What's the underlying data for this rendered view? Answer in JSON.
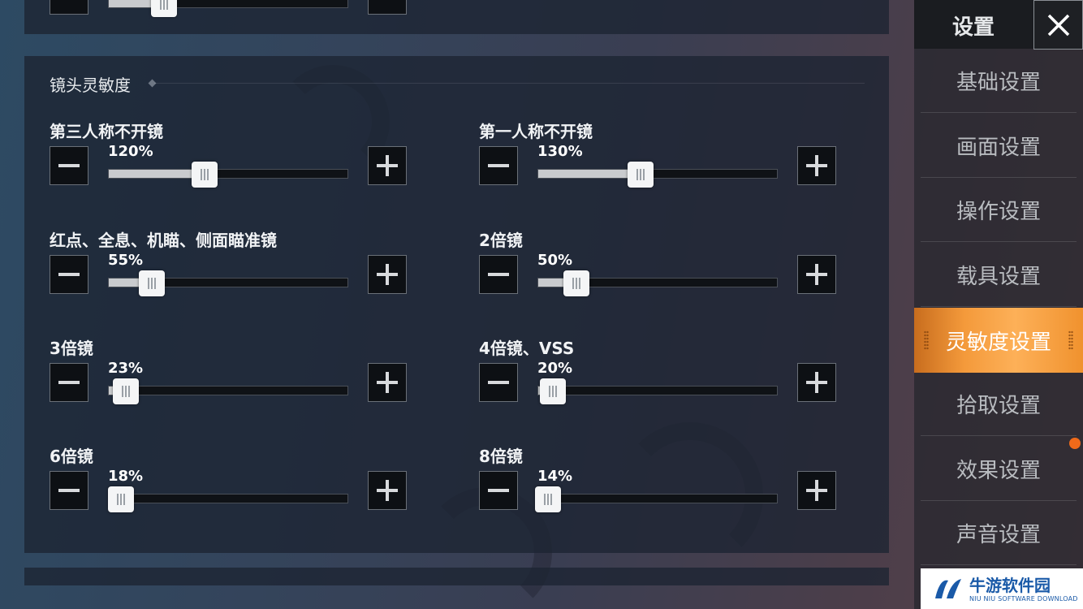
{
  "sidebar": {
    "title": "设置",
    "items": [
      {
        "label": "基础设置",
        "active": false
      },
      {
        "label": "画面设置",
        "active": false
      },
      {
        "label": "操作设置",
        "active": false
      },
      {
        "label": "载具设置",
        "active": false
      },
      {
        "label": "灵敏度设置",
        "active": true
      },
      {
        "label": "拾取设置",
        "active": false
      },
      {
        "label": "效果设置",
        "active": false
      },
      {
        "label": "声音设置",
        "active": false
      }
    ],
    "accent_color": "#f49a3b",
    "notify_color": "#f06a1a"
  },
  "section": {
    "title": "镜头灵敏度"
  },
  "top_slider": {
    "percent": 23
  },
  "settings": [
    {
      "label": "第三人称不开镜",
      "value_text": "120%",
      "fill": 0.4
    },
    {
      "label": "第一人称不开镜",
      "value_text": "130%",
      "fill": 0.43
    },
    {
      "label": "红点、全息、机瞄、侧面瞄准镜",
      "value_text": "55%",
      "fill": 0.18
    },
    {
      "label": "2倍镜",
      "value_text": "50%",
      "fill": 0.16
    },
    {
      "label": "3倍镜",
      "value_text": "23%",
      "fill": 0.07
    },
    {
      "label": "4倍镜、VSS",
      "value_text": "20%",
      "fill": 0.06
    },
    {
      "label": "6倍镜",
      "value_text": "18%",
      "fill": 0.05
    },
    {
      "label": "8倍镜",
      "value_text": "14%",
      "fill": 0.04
    }
  ],
  "watermark": {
    "title": "牛游软件园",
    "subtitle": "NIU NIU SOFTWARE DOWNLOAD"
  }
}
